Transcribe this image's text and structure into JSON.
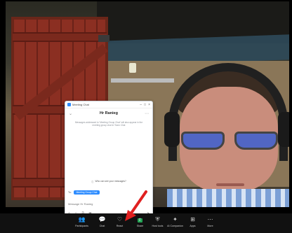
{
  "chat": {
    "window_title": "Meeting Chat",
    "header_title": "Hr Ranieg",
    "notice": "Messages addressed to 'Meeting Group Chat' will also appear in the meeting group chat in Team Chat",
    "file_notice": "Who can see your messages?",
    "to_label": "To:",
    "recipient": "Meeting Group Chat",
    "input_placeholder": "Message Hr Ranieg"
  },
  "toolbar": {
    "items": [
      {
        "label": "Participants",
        "icon": "people-icon"
      },
      {
        "label": "Chat",
        "icon": "chat-icon"
      },
      {
        "label": "React",
        "icon": "heart-icon"
      },
      {
        "label": "Share",
        "icon": "share-icon"
      },
      {
        "label": "Host tools",
        "icon": "shield-icon"
      },
      {
        "label": "AI Companion",
        "icon": "sparkle-icon"
      },
      {
        "label": "Apps",
        "icon": "apps-icon"
      },
      {
        "label": "More",
        "icon": "more-icon"
      }
    ]
  },
  "colors": {
    "accent": "#2d8cff",
    "share_green": "#23a455",
    "annotation_arrow": "#e02020"
  }
}
